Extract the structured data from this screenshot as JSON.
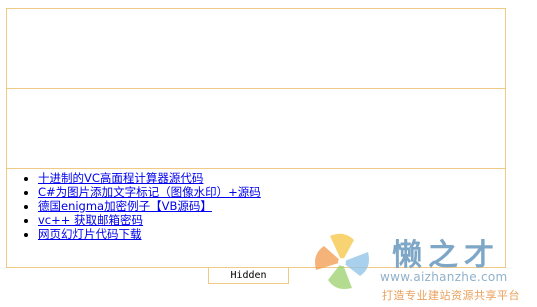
{
  "links": [
    {
      "label": "十进制的VC高面程计算器源代码"
    },
    {
      "label": "C#为图片添加文字标记（图像水印）+源码"
    },
    {
      "label": "德国enigma加密例子【VB源码】"
    },
    {
      "label": "vc++ 获取邮箱密码"
    },
    {
      "label": "网页幻灯片代码下载"
    }
  ],
  "tab": {
    "label": "Hidden"
  },
  "watermark": {
    "name": "懒之才",
    "url": "www.aizhanzhe.com",
    "slogan": "打造专业建站资源共享平台",
    "colors": {
      "text": "#7ea7c7",
      "slogan": "#e8a05c"
    }
  },
  "colors": {
    "border": "#f0c986",
    "link": "#0000ee"
  }
}
